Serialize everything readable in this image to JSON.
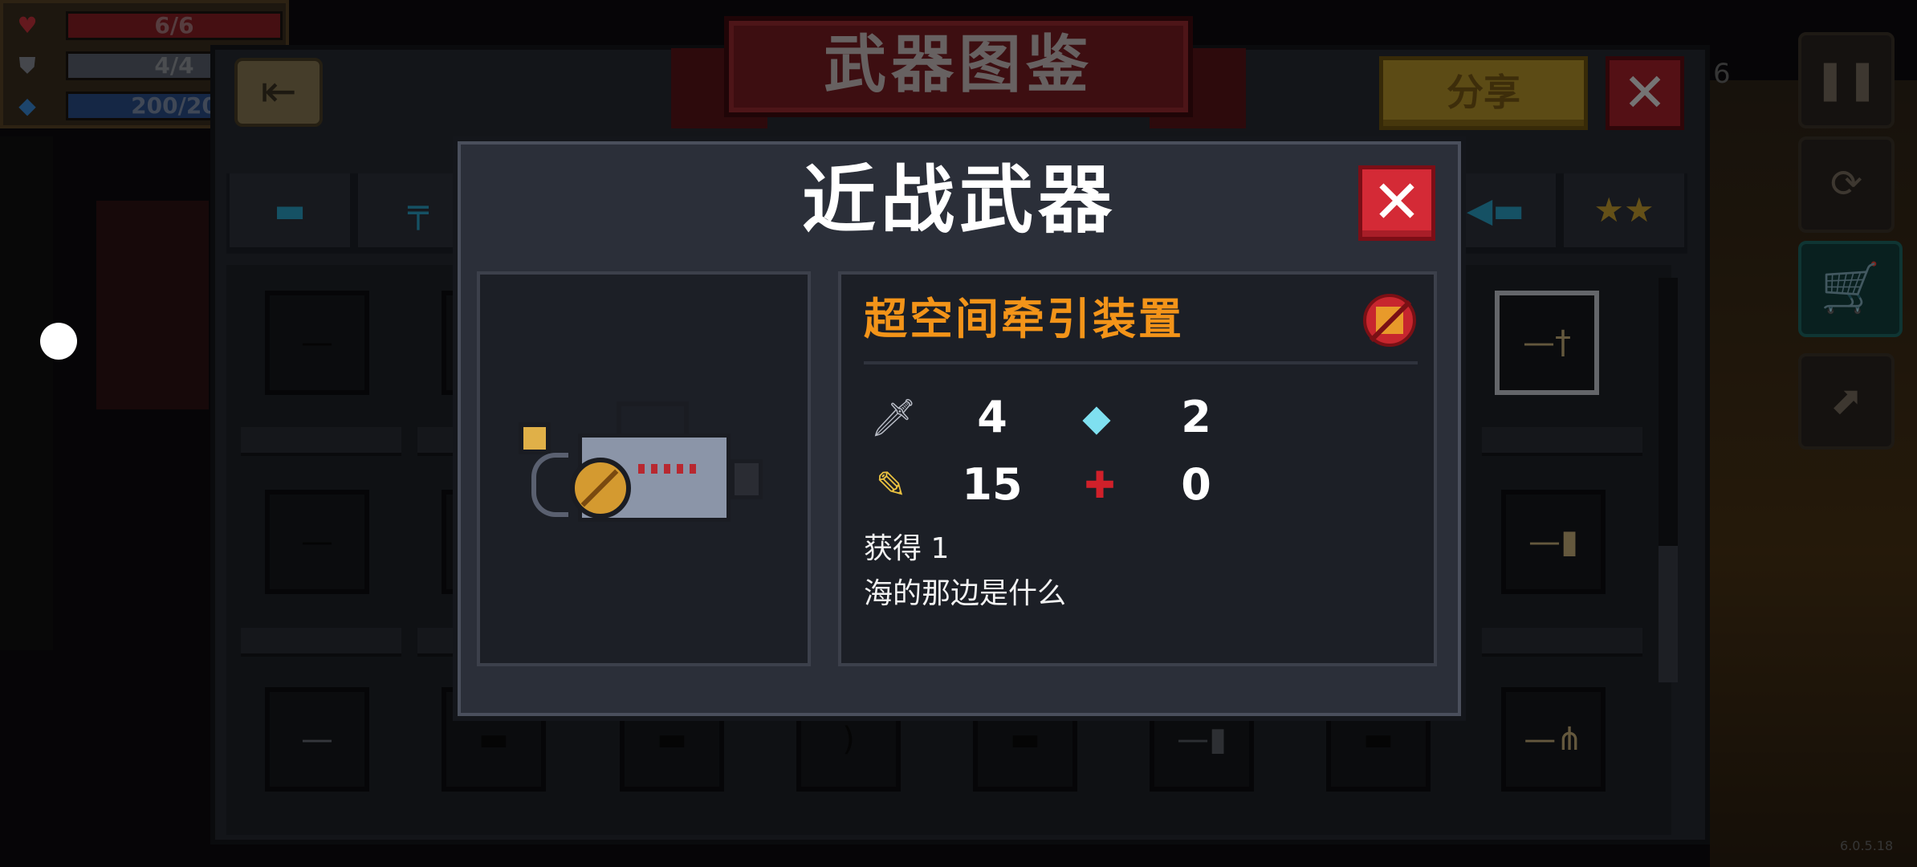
{
  "hud": {
    "hp": "6/6",
    "armor": "4/4",
    "energy": "200/20",
    "hp_icon": "heart-icon",
    "armor_icon": "shield-icon",
    "energy_icon": "diamond-icon"
  },
  "codex": {
    "title": "武器图鉴",
    "share_label": "分享",
    "close_label": "✕",
    "back_label": "⇤",
    "right_partial_text": "6"
  },
  "modal": {
    "title": "近战武器",
    "close_label": "✕",
    "weapon_name": "超空间牵引装置",
    "stats": {
      "damage": "4",
      "energy_cost": "2",
      "critical": "15",
      "inaccuracy": "0"
    },
    "obtained": "获得 1",
    "description": "海的那边是什么"
  },
  "version": "6.0.5.18",
  "colors": {
    "accent_orange": "#f39419",
    "close_red": "#d42a36",
    "share_gold": "#b8962a",
    "banner_red": "#7a1c22"
  }
}
